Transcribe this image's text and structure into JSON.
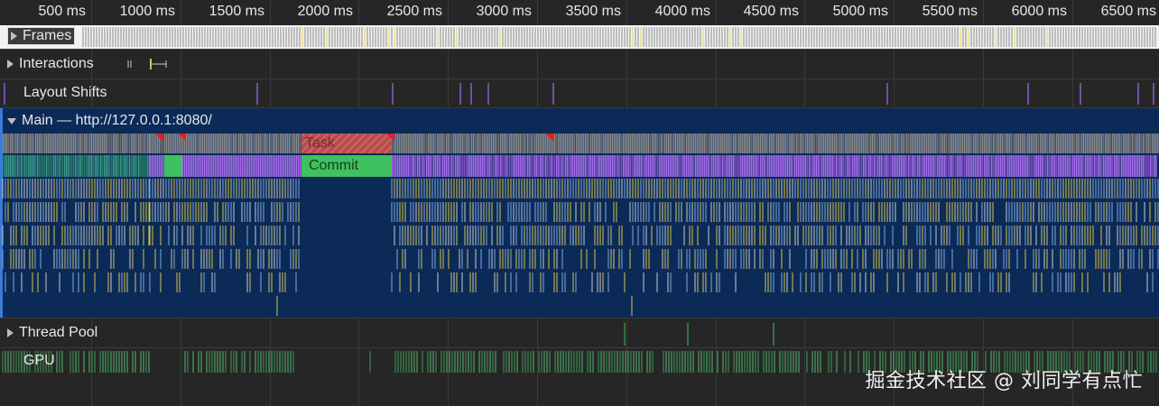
{
  "ruler": {
    "ticks": [
      "500 ms",
      "1000 ms",
      "1500 ms",
      "2000 ms",
      "2500 ms",
      "3000 ms",
      "3500 ms",
      "4000 ms",
      "4500 ms",
      "5000 ms",
      "5500 ms",
      "6000 ms",
      "6500 ms"
    ]
  },
  "tracks": {
    "frames": "Frames",
    "interactions": "Interactions",
    "layout_shifts": "Layout Shifts",
    "main": "Main — http://127.0.0.1:8080/",
    "thread_pool": "Thread Pool",
    "gpu": "GPU"
  },
  "main_events": {
    "task": "Task",
    "commit": "Commit"
  },
  "watermark": "掘金技术社区 @ 刘同学有点忙",
  "colors": {
    "background": "#262626",
    "main_area": "#0b2a57",
    "task_gray": "#8c8c8c",
    "task_long": "#c65454",
    "scripting_purple": "#a96cf0",
    "commit_green": "#3ec15e",
    "scripting_yellow": "#d9c34a",
    "gpu_green": "#3f9a57"
  }
}
